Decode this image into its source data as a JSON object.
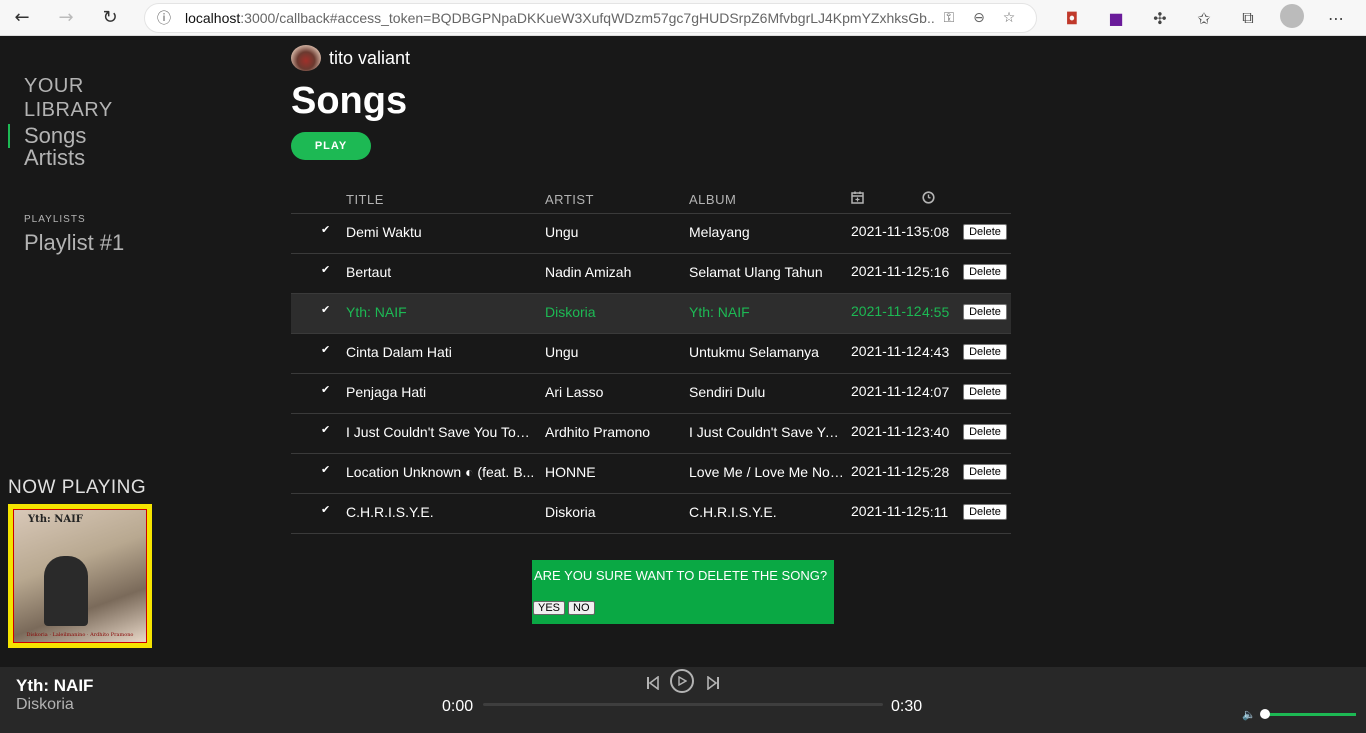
{
  "browser": {
    "url_host": "localhost",
    "url_rest": ":3000/callback#access_token=BQDBGPNpaDKKueW3XufqWDzm57gc7gHUDSrpZ6MfvbgrLJ4KpmYZxhksGb..."
  },
  "sidebar": {
    "library_title": "YOUR LIBRARY",
    "items": [
      {
        "label": "Songs"
      },
      {
        "label": "Artists"
      }
    ],
    "playlists_label": "PLAYLISTS",
    "playlists": [
      {
        "label": "Playlist #1"
      }
    ],
    "now_playing_label": "NOW PLAYING",
    "album_art_title": "Yth: NAIF",
    "album_art_caption": "Diskoria · Laleilmanino · Ardhito Pramono"
  },
  "main": {
    "user_name": "tito valiant",
    "page_title": "Songs",
    "play_label": "PLAY",
    "columns": {
      "title": "TITLE",
      "artist": "ARTIST",
      "album": "ALBUM"
    },
    "delete_label": "Delete",
    "songs": [
      {
        "title": "Demi Waktu",
        "artist": "Ungu",
        "album": "Melayang",
        "date": "2021-11-13",
        "duration": "5:08",
        "highlight": false
      },
      {
        "title": "Bertaut",
        "artist": "Nadin Amizah",
        "album": "Selamat Ulang Tahun",
        "date": "2021-11-12",
        "duration": "5:16",
        "highlight": false
      },
      {
        "title": "Yth: NAIF",
        "artist": "Diskoria",
        "album": "Yth: NAIF",
        "date": "2021-11-12",
        "duration": "4:55",
        "highlight": true
      },
      {
        "title": "Cinta Dalam Hati",
        "artist": "Ungu",
        "album": "Untukmu Selamanya",
        "date": "2021-11-12",
        "duration": "4:43",
        "highlight": false
      },
      {
        "title": "Penjaga Hati",
        "artist": "Ari Lasso",
        "album": "Sendiri Dulu",
        "date": "2021-11-12",
        "duration": "4:07",
        "highlight": false
      },
      {
        "title": "I Just Couldn't Save You Toni...",
        "artist": "Ardhito Pramono",
        "album": "I Just Couldn't Save You...",
        "date": "2021-11-12",
        "duration": "3:40",
        "highlight": false
      },
      {
        "title": "Location Unknown ◐ (feat. B...",
        "artist": "HONNE",
        "album": "Love Me / Love Me Not (...",
        "date": "2021-11-12",
        "duration": "5:28",
        "highlight": false
      },
      {
        "title": "C.H.R.I.S.Y.E.",
        "artist": "Diskoria",
        "album": "C.H.R.I.S.Y.E.",
        "date": "2021-11-12",
        "duration": "5:11",
        "highlight": false
      }
    ],
    "confirm": {
      "text": "ARE YOU SURE WANT TO DELETE THE SONG?",
      "yes": "YES",
      "no": "NO"
    }
  },
  "player": {
    "track": "Yth: NAIF",
    "artist": "Diskoria",
    "current_time": "0:00",
    "total_time": "0:30",
    "progress": 0,
    "volume": 0.02
  },
  "colors": {
    "accent": "#1db954",
    "background": "#181818",
    "player_bg": "#282828",
    "confirm_bg": "#0aa844"
  }
}
